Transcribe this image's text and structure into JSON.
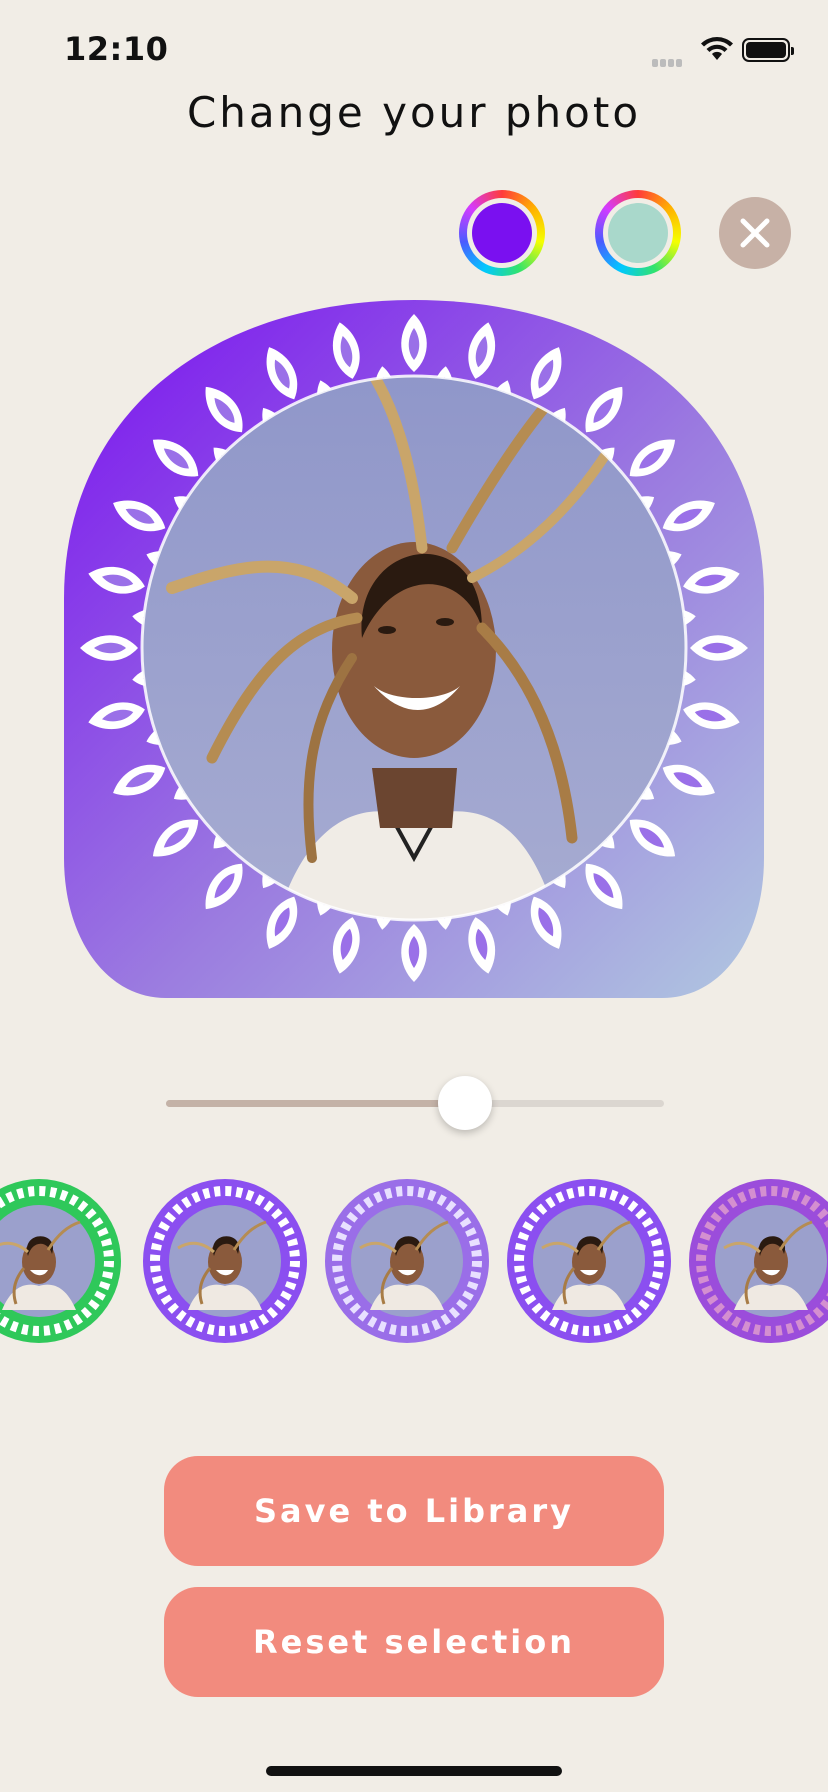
{
  "status": {
    "time": "12:10"
  },
  "header": {
    "title": "Change your photo"
  },
  "color_picker": {
    "frame_color": "#7a10f0",
    "background_color": "#a9d8cb"
  },
  "slider": {
    "value": 0.6
  },
  "frames": [
    "green-mandala-frame",
    "white-leaf-mandala-frame",
    "lace-mandala-frame",
    "petal-mandala-frame",
    "floral-wreath-frame"
  ],
  "actions": {
    "save_label": "Save to Library",
    "reset_label": "Reset selection"
  },
  "colors": {
    "background": "#f1ede6",
    "button": "#f28b7e",
    "accent_purple": "#7a10f0",
    "mint": "#a9d8cb",
    "close_gray": "#c7b1a6"
  }
}
